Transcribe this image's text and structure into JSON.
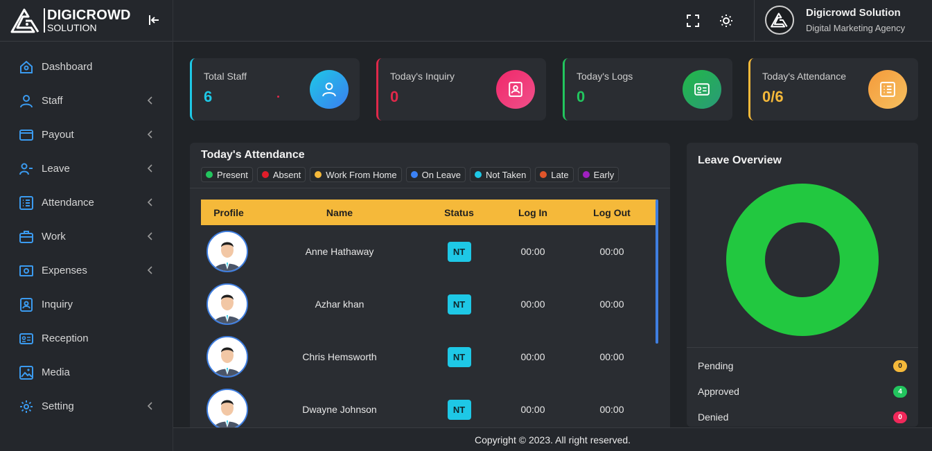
{
  "brand": {
    "name": "DIGICROWD",
    "sub": "SOLUTION"
  },
  "sidebar": {
    "items": [
      {
        "label": "Dashboard",
        "icon": "home-icon"
      },
      {
        "label": "Staff",
        "icon": "user-icon"
      },
      {
        "label": "Payout",
        "icon": "wallet-icon"
      },
      {
        "label": "Leave",
        "icon": "user-minus-icon"
      },
      {
        "label": "Attendance",
        "icon": "list-icon"
      },
      {
        "label": "Work",
        "icon": "briefcase-icon"
      },
      {
        "label": "Expenses",
        "icon": "money-icon"
      },
      {
        "label": "Inquiry",
        "icon": "contact-icon"
      },
      {
        "label": "Reception",
        "icon": "id-card-icon"
      },
      {
        "label": "Media",
        "icon": "image-icon"
      },
      {
        "label": "Setting",
        "icon": "gear-icon"
      }
    ]
  },
  "header": {
    "profile_name": "Digicrowd Solution",
    "profile_role": "Digital Marketing Agency"
  },
  "cards": [
    {
      "label": "Total Staff",
      "value": "6",
      "color": "#1ec8e6",
      "icon": "user-icon"
    },
    {
      "label": "Today's Inquiry",
      "value": "0",
      "color": "#e0284a",
      "icon": "inquiry-icon"
    },
    {
      "label": "Today's Logs",
      "value": "0",
      "color": "#22c55e",
      "icon": "id-card-icon"
    },
    {
      "label": "Today's Attendance",
      "value": "0/6",
      "color": "#f5b93a",
      "icon": "list-icon"
    }
  ],
  "attendance": {
    "title": "Today's Attendance",
    "legend": [
      {
        "label": "Present",
        "color": "#22c55e"
      },
      {
        "label": "Absent",
        "color": "#e11d2a"
      },
      {
        "label": "Work From Home",
        "color": "#f5b93a"
      },
      {
        "label": "On Leave",
        "color": "#3b82f6"
      },
      {
        "label": "Not Taken",
        "color": "#1ec8e6"
      },
      {
        "label": "Late",
        "color": "#e0552a"
      },
      {
        "label": "Early",
        "color": "#a020c0"
      }
    ],
    "columns": [
      "Profile",
      "Name",
      "Status",
      "Log In",
      "Log Out"
    ],
    "rows": [
      {
        "name": "Anne Hathaway",
        "status": "NT",
        "login": "00:00",
        "logout": "00:00"
      },
      {
        "name": "Azhar khan",
        "status": "NT",
        "login": "00:00",
        "logout": "00:00"
      },
      {
        "name": "Chris Hemsworth",
        "status": "NT",
        "login": "00:00",
        "logout": "00:00"
      },
      {
        "name": "Dwayne Johnson",
        "status": "NT",
        "login": "00:00",
        "logout": "00:00"
      }
    ]
  },
  "leave": {
    "title": "Leave Overview",
    "items": [
      {
        "label": "Pending",
        "count": "0",
        "color": "#f5b93a"
      },
      {
        "label": "Approved",
        "count": "4",
        "color": "#22c55e"
      },
      {
        "label": "Denied",
        "count": "0",
        "color": "#f0285a"
      }
    ],
    "donut_color": "#22c840"
  },
  "footer": {
    "text": "Copyright © 2023. All right reserved."
  }
}
